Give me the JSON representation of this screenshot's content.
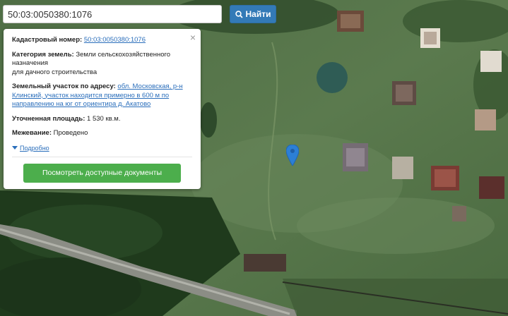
{
  "search": {
    "value": "50:03:0050380:1076",
    "button_label": "Найти"
  },
  "info_panel": {
    "close_symbol": "×",
    "cadastral_label": "Кадастровый номер:",
    "cadastral_value": "50:03:0050380:1076",
    "category_label": "Категория земель:",
    "category_line1": "Земли сельскохозяйственного",
    "category_line2": "назначения",
    "category_line3": "для дачного строительства",
    "address_label": "Земельный участок по адресу:",
    "address_line1": "обл. Московская, р-н",
    "address_line2": "Клинский, участок находится примерно в 600 м по",
    "address_line3": "направлению на юг от ориентира д. Акатово",
    "area_label": "Уточненная площадь:",
    "area_value": "1 530 кв.м.",
    "survey_label": "Межевание:",
    "survey_value": "Проведено",
    "details_link": "Подробно",
    "documents_button": "Посмотреть доступные документы"
  },
  "icons": {
    "search_button": "search-icon",
    "close": "close-icon",
    "details": "triangle-down-icon",
    "map_marker": "map-pin-icon"
  },
  "colors": {
    "primary_button": "#337ab7",
    "success_button": "#4cae4c",
    "link": "#2a6ebb",
    "marker": "#2c7fd6"
  }
}
